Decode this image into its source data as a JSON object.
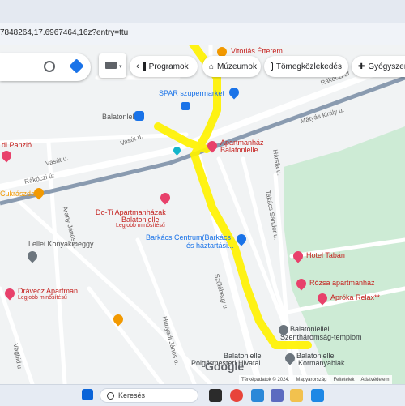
{
  "browser": {
    "url": "7848264,17.6967464,16z?entry=ttu"
  },
  "search": {
    "search_icon": "search-icon",
    "directions_icon": "directions-icon"
  },
  "chips": [
    {
      "label": "Programok",
      "icon": "ticket-icon"
    },
    {
      "label": "Múzeumok",
      "icon": "museum-icon"
    },
    {
      "label": "Tömegközlekedés",
      "icon": "train-icon"
    },
    {
      "label": "Gyógyszer",
      "icon": "pharmacy-icon"
    }
  ],
  "map_labels": {
    "vitorlas": "Vitorlás Étterem",
    "spar": "SPAR szupermarket",
    "station": "Balatonlelle",
    "rakoczi_top": "Rákóczi út",
    "matyas": "Mátyás király u.",
    "panzio": "di Panzió",
    "vasut1": "Vasút u.",
    "vasut2": "Vasút u.",
    "apartmanhaz": "Apartmanház",
    "apartmanhaz2": "Balatonlelle",
    "harsfa": "Hársfa u.",
    "rakoczi_left": "Rákóczi út",
    "cukraszda": "Cukrászda",
    "arany": "Arany János u.",
    "takacs": "Takács Sándor u.",
    "do_ti": "Do-Ti Apartmanházak",
    "do_ti2": "Balatonlelle",
    "do_ti_sub": "Legjobb minősítésű",
    "barkacs": "Barkács Centrum(Barkács",
    "barkacs2": "és háztartási...",
    "lellei": "Lellei Konyakmeggy",
    "taban": "Hotel Tabán",
    "rozsa": "Rózsa apartmanház",
    "szolo": "Szőlőhegy u.",
    "dravecz": "Drávecz Apartman",
    "dravecz_sub": "Legjobb minősítésű",
    "aproka": "Aprókа Relax**",
    "templom": "Balatonlellei",
    "templom2": "Szentháromság-templom",
    "hunyadi": "Hunyadi János u.",
    "vaghid": "Vághid u.",
    "hivatal": "Balatonlellei",
    "hivatal2": "Polgármesteri Hivatal",
    "kormanyablak": "Balatonlellei",
    "kormanyablak2": "Kormányablak",
    "google": "Google"
  },
  "attribution": {
    "data": "Térképadatok © 2024.",
    "country": "Magyarország",
    "terms": "Feltételek",
    "privacy": "Adatvédelem"
  },
  "taskbar": {
    "search_label": "Keresés"
  },
  "colors": {
    "highlight": "#fff200",
    "railway": "#8a9bb0",
    "park": "#cdebd5",
    "road": "#ffffff",
    "poi_red": "#c5221f",
    "blue": "#1a73e8"
  }
}
